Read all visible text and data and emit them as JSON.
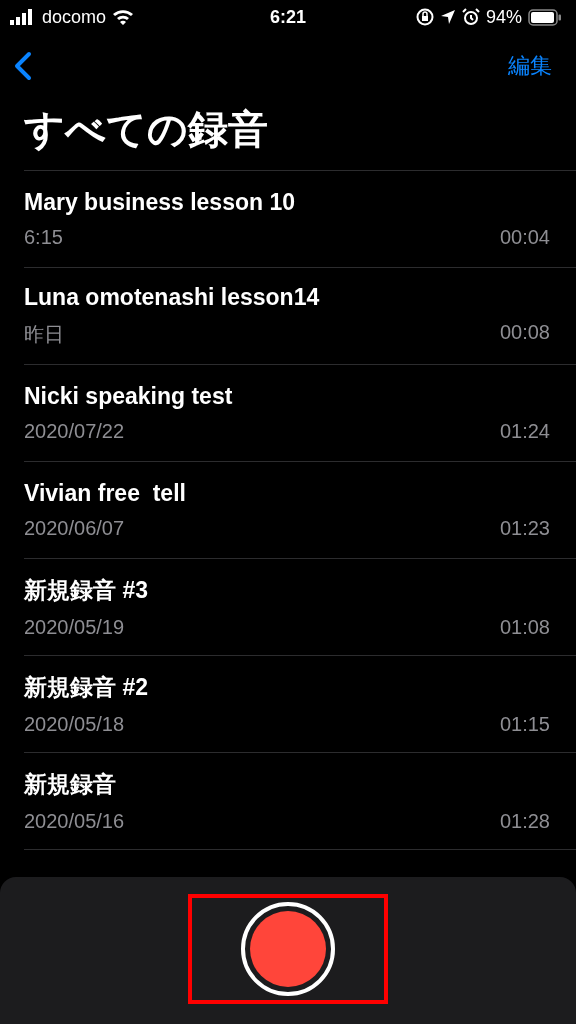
{
  "status_bar": {
    "carrier": "docomo",
    "time": "6:21",
    "battery": "94%"
  },
  "nav": {
    "edit": "編集"
  },
  "title": "すべての録音",
  "recordings": [
    {
      "name": "Mary business lesson 10",
      "date": "6:15",
      "duration": "00:04"
    },
    {
      "name": "Luna omotenashi lesson14",
      "date": "昨日",
      "duration": "00:08"
    },
    {
      "name": "Nicki speaking test",
      "date": "2020/07/22",
      "duration": "01:24"
    },
    {
      "name": "Vivian free  tell",
      "date": "2020/06/07",
      "duration": "01:23"
    },
    {
      "name": "新規録音 #3",
      "date": "2020/05/19",
      "duration": "01:08"
    },
    {
      "name": "新規録音 #2",
      "date": "2020/05/18",
      "duration": "01:15"
    },
    {
      "name": "新規録音",
      "date": "2020/05/16",
      "duration": "01:28"
    }
  ],
  "record_button": {
    "highlighted": true
  }
}
